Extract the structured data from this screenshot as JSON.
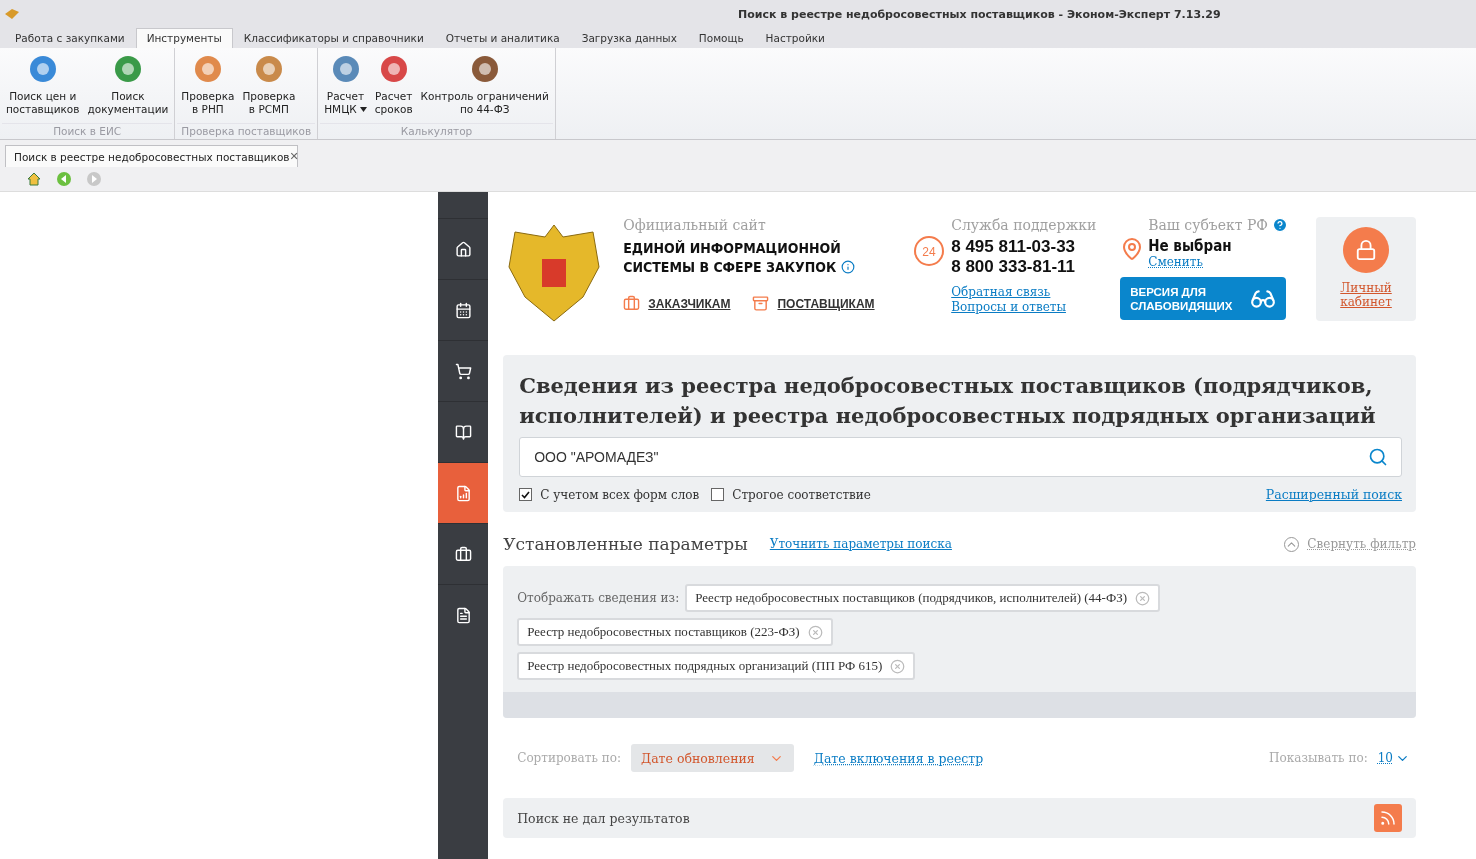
{
  "window": {
    "title": "Поиск в реестре недобросовестных поставщиков - Эконом-Эксперт 7.13.29"
  },
  "menu_tabs": [
    {
      "label": "Работа с закупками",
      "selected": false
    },
    {
      "label": "Инструменты",
      "selected": true
    },
    {
      "label": "Классификаторы и справочники",
      "selected": false
    },
    {
      "label": "Отчеты и аналитика",
      "selected": false
    },
    {
      "label": "Загрузка данных",
      "selected": false
    },
    {
      "label": "Помощь",
      "selected": false
    },
    {
      "label": "Настройки",
      "selected": false
    }
  ],
  "ribbon_groups": [
    {
      "title": "Поиск в ЕИС",
      "items": [
        {
          "lines": [
            "Поиск цен и",
            "поставщиков"
          ]
        },
        {
          "lines": [
            "Поиск",
            "документации"
          ]
        }
      ]
    },
    {
      "title": "Проверка поставщиков",
      "items": [
        {
          "lines": [
            "Проверка",
            "в РНП"
          ]
        },
        {
          "lines": [
            "Проверка",
            "в РСМП"
          ]
        }
      ]
    },
    {
      "title": "Калькулятор",
      "items": [
        {
          "lines": [
            "Расчет",
            "НМЦК"
          ],
          "dropdown": true
        },
        {
          "lines": [
            "Расчет",
            "сроков"
          ]
        },
        {
          "lines": [
            "Контроль ограничений",
            "по 44-ФЗ"
          ]
        }
      ]
    }
  ],
  "document_tab": {
    "title": "Поиск в реестре недобросовестных поставщиков",
    "close": "✕"
  },
  "sidebar": {
    "items": [
      {
        "selected": false
      },
      {
        "selected": false
      },
      {
        "selected": false
      },
      {
        "selected": false
      },
      {
        "selected": true
      },
      {
        "selected": false
      },
      {
        "selected": false
      }
    ]
  },
  "header": {
    "site_caption": "Официальный сайт",
    "site_name": [
      "ЕДИНОЙ ИНФОРМАЦИОННОЙ",
      "СИСТЕМЫ В СФЕРЕ ЗАКУПОК"
    ],
    "links": [
      "ЗАКАЗЧИКАМ",
      "ПОСТАВЩИКАМ"
    ],
    "support_caption": "Служба поддержки",
    "support_badge": "24",
    "phones": [
      "8 495 811-03-33",
      "8 800 333-81-11"
    ],
    "support_links": [
      "Обратная связь",
      "Вопросы и ответы"
    ],
    "region_caption": "Ваш субъект РФ",
    "region_value": "Не выбран",
    "region_change": "Сменить",
    "accessibility_button": [
      "ВЕРСИЯ ДЛЯ",
      "СЛАБОВИДЯЩИХ"
    ],
    "account_link": [
      "Личный",
      "кабинет"
    ]
  },
  "search": {
    "title": "Сведения из реестра недобросовестных поставщиков (подрядчиков, исполнителей) и реестра недобросовестных подрядных организаций",
    "value": "ООО \"АРОМАДЕЗ\"",
    "options": [
      {
        "label": "С учетом всех форм слов",
        "checked": true
      },
      {
        "label": "Строгое соответствие",
        "checked": false
      }
    ],
    "advanced_link": "Расширенный поиск"
  },
  "parameters": {
    "title": "Установленные параметры",
    "refine_link": "Уточнить параметры поиска",
    "collapse_link": "Свернуть фильтр",
    "sources_label": "Отображать сведения из:",
    "sources": [
      "Реестр недобросовестных поставщиков (подрядчиков, исполнителей) (44-ФЗ)",
      "Реестр недобросовестных поставщиков (223-ФЗ)",
      "Реестр недобросовестных подрядных организаций (ПП РФ 615)"
    ]
  },
  "sorting": {
    "label": "Сортировать по:",
    "options": [
      {
        "label": "Дате обновления",
        "selected": true
      },
      {
        "label": "Дате включения в реестр",
        "selected": false
      }
    ],
    "page_size_label": "Показывать по:",
    "page_size": "10"
  },
  "results": {
    "message": "Поиск не дал результатов"
  }
}
